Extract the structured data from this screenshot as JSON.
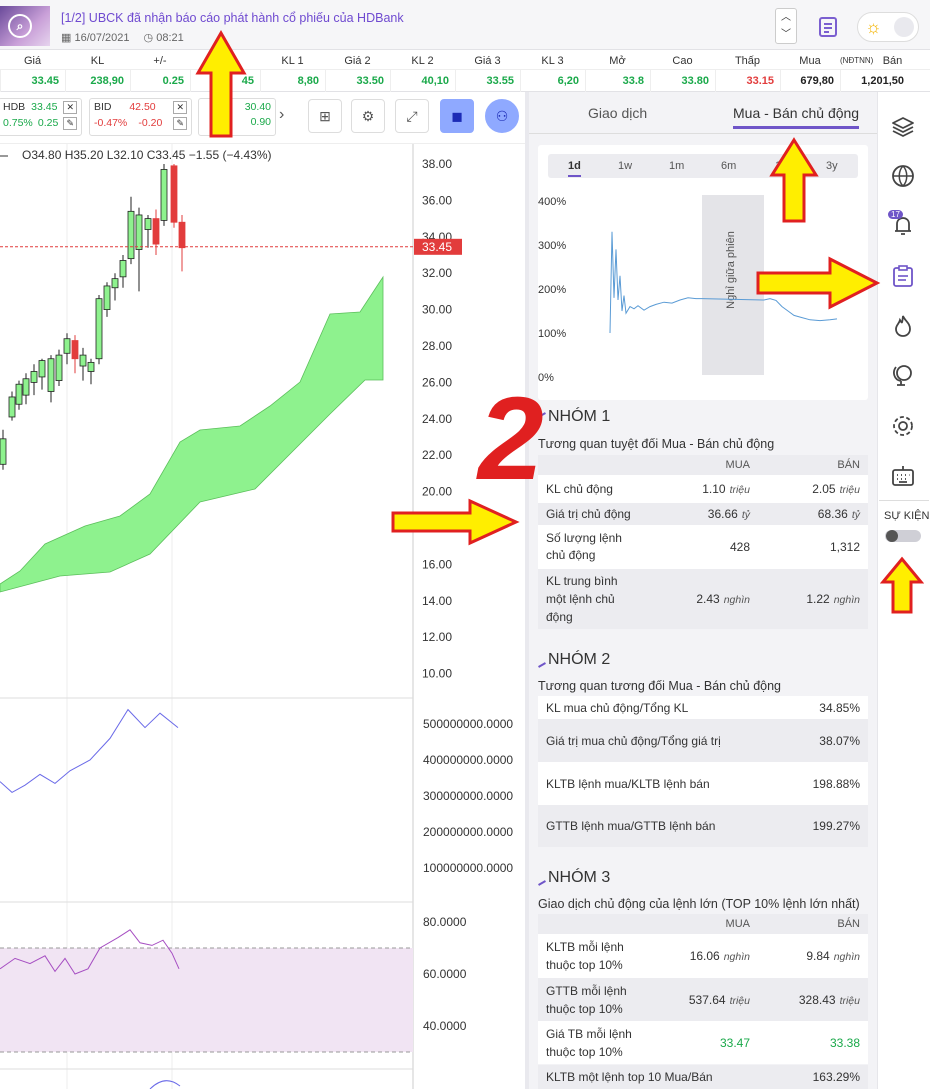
{
  "news": {
    "title": "[1/2]   UBCK đã nhận báo cáo phát hành cổ phiếu của HDBank",
    "date": "16/07/2021",
    "time": "08:21"
  },
  "quote_header": [
    "Giá",
    "KL",
    "+/-",
    "",
    "KL 1",
    "Giá 2",
    "KL 2",
    "Giá 3",
    "KL 3",
    "Mở",
    "Cao",
    "Thấp",
    "Mua",
    "(NĐTNN)",
    "Bán"
  ],
  "quote_values": [
    "33.45",
    "238,90",
    "0.25",
    "45",
    "8,80",
    "33.50",
    "40,10",
    "33.55",
    "6,20",
    "33.8",
    "33.80",
    "33.15",
    "679,80",
    "1,201,50"
  ],
  "tickers": [
    {
      "code": "HDB",
      "price": "33.45",
      "pct": "0.75%",
      "chg": "0.25"
    },
    {
      "code": "BID",
      "price": "42.50",
      "pct": "-0.47%",
      "chg": "-0.20"
    },
    {
      "code": "",
      "price": "30.40",
      "pct": "",
      "chg": "0.90"
    }
  ],
  "ohlc": "O34.80  H35.20  L32.10  C33.45  −1.55 (−4.43%)",
  "price_axis": [
    "38.00",
    "36.00",
    "34.00",
    "32.00",
    "30.00",
    "28.00",
    "26.00",
    "24.00",
    "22.00",
    "20.00",
    "18.00",
    "16.00",
    "14.00",
    "12.00",
    "10.00"
  ],
  "last_price": "33.45",
  "vol_axis": [
    "500000000.0000",
    "400000000.0000",
    "300000000.0000",
    "200000000.0000",
    "100000000.0000"
  ],
  "rsi_axis": [
    "80.0000",
    "60.0000",
    "40.0000"
  ],
  "tabs": {
    "trade": "Giao dịch",
    "active_buy_sell": "Mua - Bán chủ động"
  },
  "periods": [
    "1d",
    "1w",
    "1m",
    "6m",
    "1",
    "3y"
  ],
  "mini_chart": {
    "yaxis": [
      "400%",
      "300%",
      "200%",
      "100%",
      "0%"
    ],
    "break_label": "Nghỉ giữa phiên"
  },
  "annotation_number": "2",
  "group1": {
    "title": "NHÓM 1",
    "subtitle": "Tương quan tuyệt đối Mua - Bán chủ động",
    "col_buy": "MUA",
    "col_sell": "BÁN",
    "rows": [
      {
        "label": "KL chủ động",
        "buy": "1.10",
        "buy_unit": "triệu",
        "sell": "2.05",
        "sell_unit": "triệu"
      },
      {
        "label": "Giá trị chủ động",
        "buy": "36.66",
        "buy_unit": "tỷ",
        "sell": "68.36",
        "sell_unit": "tỷ"
      },
      {
        "label": "Số lượng lệnh chủ động",
        "buy": "428",
        "buy_unit": "",
        "sell": "1,312",
        "sell_unit": ""
      },
      {
        "label": "KL trung bình một lệnh chủ động",
        "buy": "2.43",
        "buy_unit": "nghìn",
        "sell": "1.22",
        "sell_unit": "nghìn"
      }
    ]
  },
  "group2": {
    "title": "NHÓM 2",
    "subtitle": "Tương quan tương đối Mua - Bán chủ động",
    "rows": [
      {
        "label": "KL mua chủ động/Tổng KL",
        "value": "34.85%"
      },
      {
        "label": "Giá trị mua chủ động/Tổng giá trị",
        "value": "38.07%"
      },
      {
        "label": "KLTB lệnh mua/KLTB lệnh bán",
        "value": "198.88%"
      },
      {
        "label": "GTTB lệnh mua/GTTB lệnh bán",
        "value": "199.27%"
      }
    ]
  },
  "group3": {
    "title": "NHÓM 3",
    "subtitle": "Giao dịch chủ động của lệnh lớn (TOP 10% lệnh lớn nhất)",
    "col_buy": "MUA",
    "col_sell": "BÁN",
    "rows": [
      {
        "label": "KLTB mỗi lệnh thuộc top 10%",
        "buy": "16.06",
        "buy_unit": "nghìn",
        "sell": "9.84",
        "sell_unit": "nghìn"
      },
      {
        "label": "GTTB mỗi lệnh thuộc top 10%",
        "buy": "537.64",
        "buy_unit": "triệu",
        "sell": "328.43",
        "sell_unit": "triệu"
      },
      {
        "label": "Giá TB mỗi lệnh thuộc top 10%",
        "buy": "33.47",
        "buy_unit": "",
        "sell": "33.38",
        "sell_unit": ""
      }
    ],
    "last_row": {
      "label": "KLTB một lệnh top 10 Mua/Bán",
      "value": "163.29%"
    }
  },
  "sidebar": {
    "badge": "17",
    "event_label": "SỰ KIỆN"
  },
  "colors": {
    "accent": "#6f55c8",
    "up": "#1aa94a",
    "down": "#e23c3c",
    "cloud": "#8ef28e",
    "arrow_fill": "#ffee00",
    "arrow_stroke": "#e02020"
  }
}
